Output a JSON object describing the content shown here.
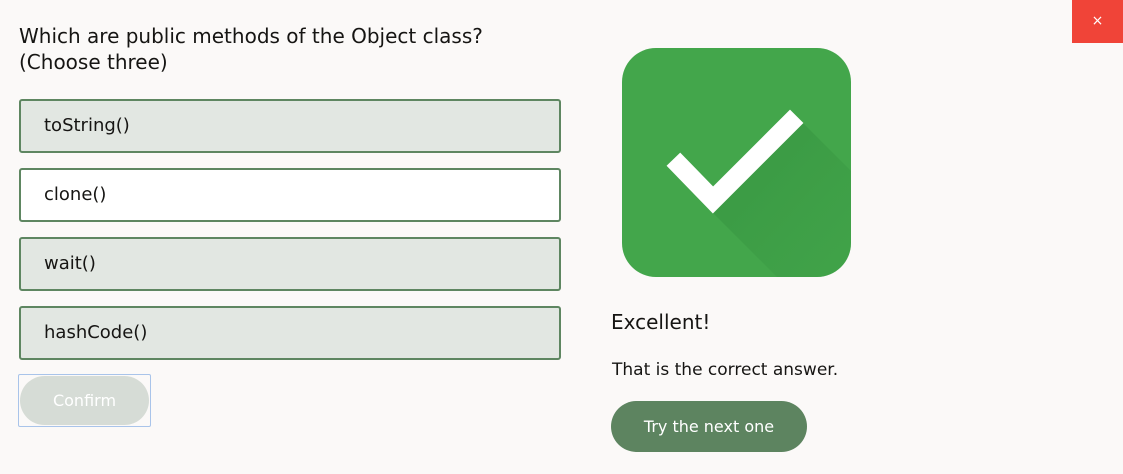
{
  "close": {
    "label": "×"
  },
  "question": {
    "line1": "Which are public methods of the Object class?",
    "line2": "(Choose three)"
  },
  "options": [
    {
      "label": "toString()",
      "selected": true
    },
    {
      "label": "clone()",
      "selected": false
    },
    {
      "label": "wait()",
      "selected": true
    },
    {
      "label": "hashCode()",
      "selected": true
    }
  ],
  "confirm": {
    "label": "Confirm",
    "enabled": false
  },
  "result": {
    "icon": "checkmark-icon",
    "title": "Excellent!",
    "message": "That is the correct answer.",
    "next_label": "Try the next one"
  },
  "colors": {
    "accent_green": "#5d8460",
    "icon_green": "#43a64b",
    "close_red": "#f04438"
  }
}
